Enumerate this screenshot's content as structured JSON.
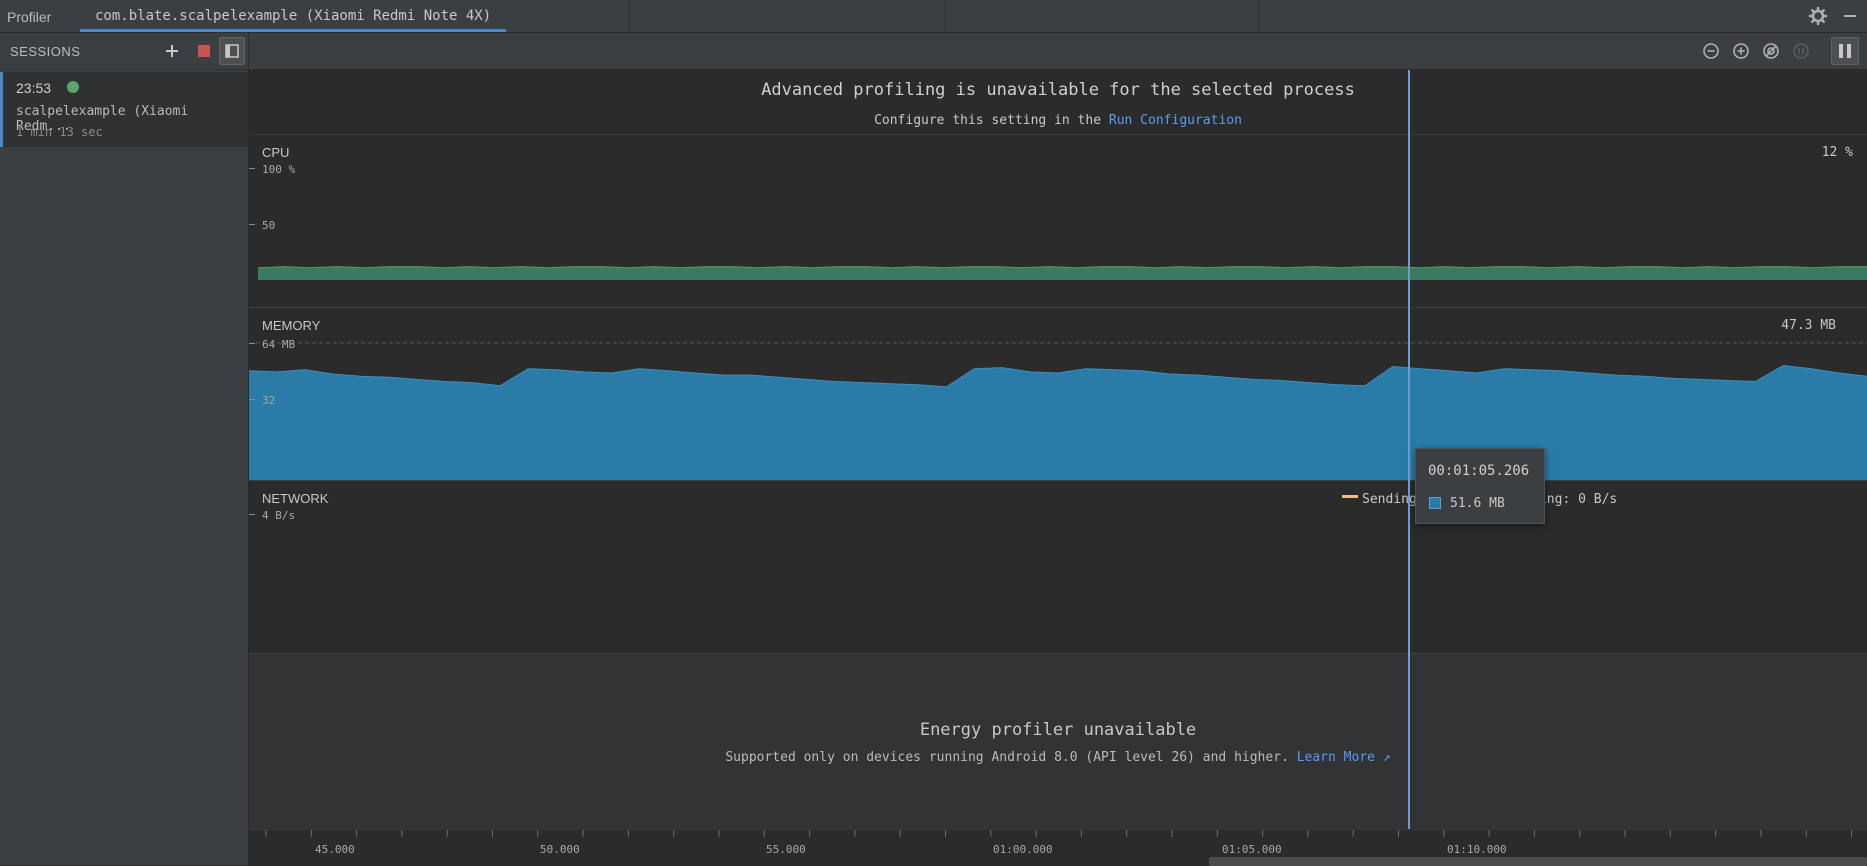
{
  "window": {
    "tool_title": "Profiler",
    "process_tab": "com.blate.scalpelexample (Xiaomi Redmi Note 4X)"
  },
  "sessions": {
    "title": "SESSIONS",
    "item": {
      "time": "23:53",
      "name": "scalpelexample (Xiaomi Redm...",
      "duration": "1 min 13 sec"
    }
  },
  "banner": {
    "title": "Advanced profiling is unavailable for the selected process",
    "sub_prefix": "Configure this setting in the ",
    "sub_link": "Run Configuration"
  },
  "cpu": {
    "title": "CPU",
    "current": "12 %",
    "axis": [
      "100 %",
      "50"
    ]
  },
  "memory": {
    "title": "MEMORY",
    "current": "47.3 MB",
    "axis": [
      "64 MB",
      "32"
    ]
  },
  "network": {
    "title": "NETWORK",
    "axis": [
      "4 B/s"
    ],
    "legend_sending": "Sending: 0 B/s",
    "legend_receiving": "Receiving: 0 B/s"
  },
  "energy": {
    "title": "Energy profiler unavailable",
    "sub_prefix": "Supported only on devices running Android 8.0 (API level 26) and higher. ",
    "sub_link": "Learn More"
  },
  "tooltip": {
    "time": "00:01:05.206",
    "value": "51.6 MB"
  },
  "timeline": {
    "labels": [
      "45.000",
      "50.000",
      "55.000",
      "01:00.000",
      "01:05.000",
      "01:10.000"
    ]
  },
  "colors": {
    "cpu_fill": "#3b7a5e",
    "memory_fill": "#2a7ba7",
    "cursor": "#6f9ad8",
    "sending": "#f2c27c",
    "receiving": "#5b8fde",
    "accent": "#4a88c7"
  },
  "chart_data": [
    {
      "type": "area",
      "title": "CPU",
      "ylim": [
        0,
        100
      ],
      "unit": "%",
      "values": [
        11,
        12,
        11,
        12,
        11,
        12,
        12,
        11,
        12,
        11,
        12,
        11,
        12,
        12,
        11,
        12,
        11,
        12,
        12,
        11,
        12,
        11,
        12,
        12,
        11,
        12,
        11,
        12,
        12,
        11,
        12,
        11,
        12,
        12,
        11,
        12,
        11,
        12,
        12,
        11,
        12,
        11,
        12,
        12,
        11,
        12,
        11,
        12,
        12,
        11,
        12,
        11,
        12,
        12,
        11,
        12,
        11,
        12,
        12,
        11,
        12,
        12
      ]
    },
    {
      "type": "area",
      "title": "MEMORY",
      "ylim": [
        0,
        64
      ],
      "unit": "MB",
      "values": [
        51,
        50.5,
        51.5,
        49.5,
        48.5,
        48,
        47,
        46,
        45.5,
        44,
        52,
        51.5,
        50.5,
        50,
        52,
        51,
        50,
        49,
        49,
        48,
        47,
        46,
        45.5,
        45,
        44.5,
        43.5,
        52,
        52.5,
        50.5,
        50,
        52,
        51.5,
        51,
        49.5,
        49,
        48,
        47,
        46.5,
        45.5,
        44.5,
        44,
        53,
        52,
        51,
        50,
        52,
        51.5,
        51,
        50,
        49,
        48.5,
        47.5,
        47,
        46.5,
        46,
        53.5,
        52,
        50,
        48.5
      ]
    }
  ]
}
